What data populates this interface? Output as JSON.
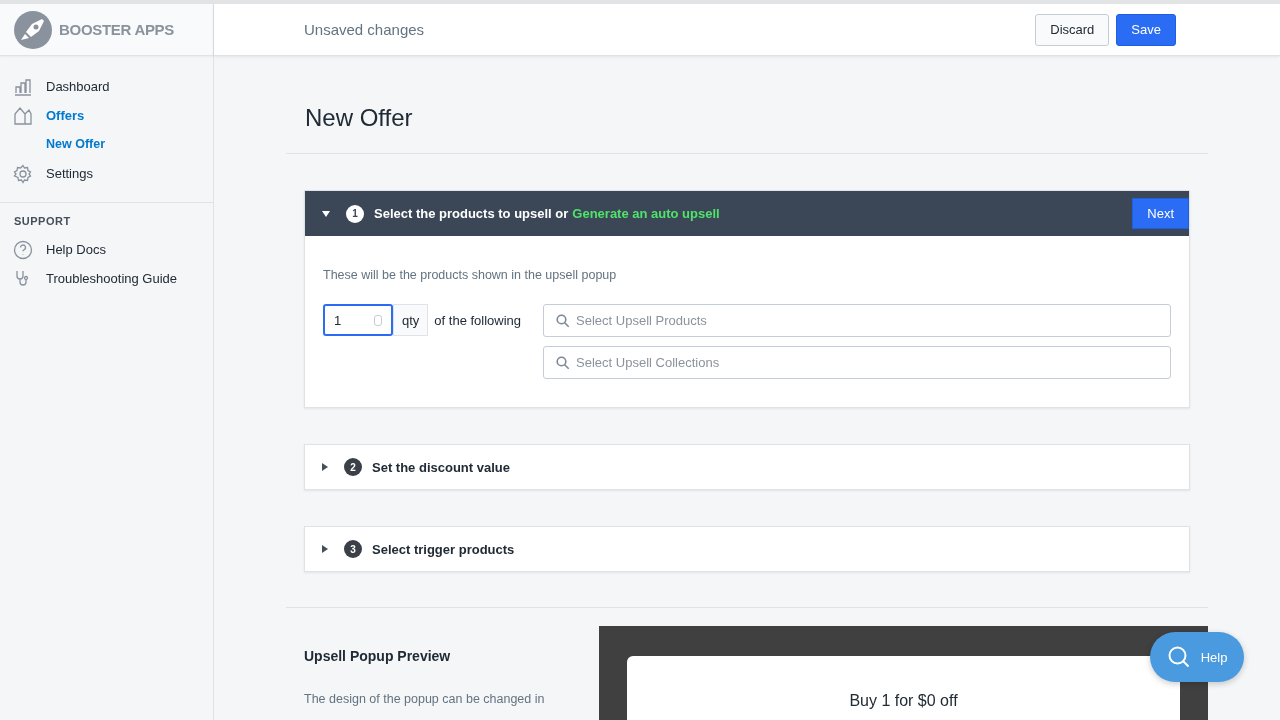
{
  "brand": {
    "name": "BOOSTER APPS"
  },
  "topbar": {
    "title": "Unsaved changes",
    "buttons": [
      {
        "label": "Discard",
        "kind": "secondary"
      },
      {
        "label": "Save",
        "kind": "primary"
      }
    ]
  },
  "sidebar": {
    "items": [
      {
        "label": "Dashboard",
        "kind": "chart",
        "selected": false
      },
      {
        "label": "Offers",
        "kind": "tag",
        "selected": true,
        "children": [
          {
            "label": "New Offer",
            "selected": true
          }
        ]
      },
      {
        "label": "Settings",
        "kind": "gear",
        "selected": false
      }
    ],
    "support_heading": "SUPPORT",
    "support_items": [
      {
        "label": "Help Docs",
        "kind": "help"
      },
      {
        "label": "Troubleshooting Guide",
        "kind": "stethoscope"
      }
    ]
  },
  "page_title": "New Offer",
  "steps": [
    {
      "number": "1",
      "title": "Select the products to upsell or",
      "link": "Generate an auto upsell",
      "expanded": true,
      "next": "Next",
      "description": "These will be the products shown in the upsell popup",
      "qty_value": "1",
      "qty_label": "qty",
      "of_label": "of the following",
      "search_fields": [
        {
          "placeholder": "Select Upsell Products"
        },
        {
          "placeholder": "Select Upsell Collections"
        }
      ]
    },
    {
      "number": "2",
      "title": "Set the discount value",
      "expanded": false
    },
    {
      "number": "3",
      "title": "Select trigger products",
      "expanded": false
    }
  ],
  "preview": {
    "title": "Upsell Popup Preview",
    "description": "The design of the popup can be changed in",
    "popup_text": "Buy 1 for $0 off"
  },
  "help_button": {
    "label": "Help"
  }
}
